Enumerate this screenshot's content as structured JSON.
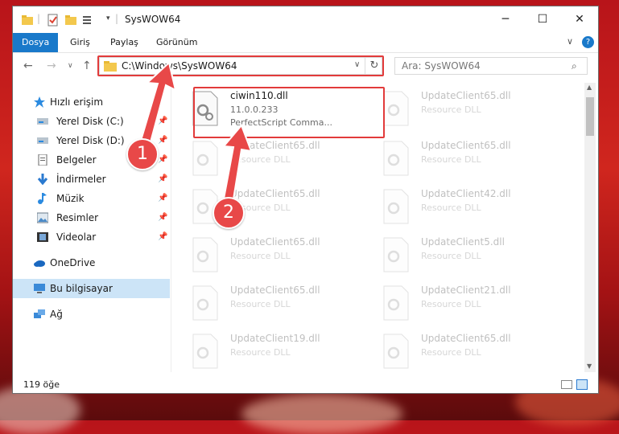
{
  "window": {
    "title": "SysWOW64",
    "minimize_glyph": "─",
    "maximize_glyph": "☐",
    "close_glyph": "✕"
  },
  "ribbon": {
    "tabs": [
      {
        "label": "Dosya"
      },
      {
        "label": "Giriş"
      },
      {
        "label": "Paylaş"
      },
      {
        "label": "Görünüm"
      }
    ],
    "help_glyph": "?",
    "expand_glyph": "∨"
  },
  "address": {
    "path": "C:\\Windows\\SysWOW64",
    "dropdown_glyph": "∨",
    "refresh_glyph": "↻"
  },
  "search": {
    "placeholder": "Ara: SysWOW64",
    "icon": "search-icon"
  },
  "sidebar": {
    "items": [
      {
        "label": "Hızlı erişim",
        "icon": "star-icon"
      },
      {
        "label": "Yerel Disk (C:)",
        "icon": "drive-icon"
      },
      {
        "label": "Yerel Disk (D:)",
        "icon": "drive-icon"
      },
      {
        "label": "Belgeler",
        "icon": "documents-icon"
      },
      {
        "label": "İndirmeler",
        "icon": "download-icon"
      },
      {
        "label": "Müzik",
        "icon": "music-icon"
      },
      {
        "label": "Resimler",
        "icon": "pictures-icon"
      },
      {
        "label": "Videolar",
        "icon": "videos-icon"
      },
      {
        "label": "OneDrive",
        "icon": "cloud-icon"
      },
      {
        "label": "Bu bilgisayar",
        "icon": "computer-icon"
      },
      {
        "label": "Ağ",
        "icon": "network-icon"
      }
    ]
  },
  "files": {
    "highlighted": {
      "name": "ciwin110.dll",
      "version": "11.0.0.233",
      "description": "PerfectScript Comma..."
    },
    "faded_left": [
      {
        "name": "UpdateClient65.dll",
        "type": "Resource DLL"
      },
      {
        "name": "UpdateClient65.dll",
        "type": "Resource DLL"
      },
      {
        "name": "UpdateClient65.dll",
        "type": "Resource DLL"
      },
      {
        "name": "UpdateClient65.dll",
        "type": "Resource DLL"
      },
      {
        "name": "UpdateClient19.dll",
        "type": "Resource DLL"
      }
    ],
    "faded_right": [
      {
        "name": "UpdateClient65.dll",
        "type": "Resource DLL"
      },
      {
        "name": "UpdateClient65.dll",
        "type": "Resource DLL"
      },
      {
        "name": "UpdateClient42.dll",
        "type": "Resource DLL"
      },
      {
        "name": "UpdateClient5.dll",
        "type": "Resource DLL"
      },
      {
        "name": "UpdateClient21.dll",
        "type": "Resource DLL"
      },
      {
        "name": "UpdateClient65.dll",
        "type": "Resource DLL"
      }
    ]
  },
  "status": {
    "item_count": "119 öğe"
  },
  "annotations": {
    "badge1": "1",
    "badge2": "2"
  },
  "colors": {
    "accent": "#1979ca",
    "annotation_red": "#e23b3b"
  }
}
